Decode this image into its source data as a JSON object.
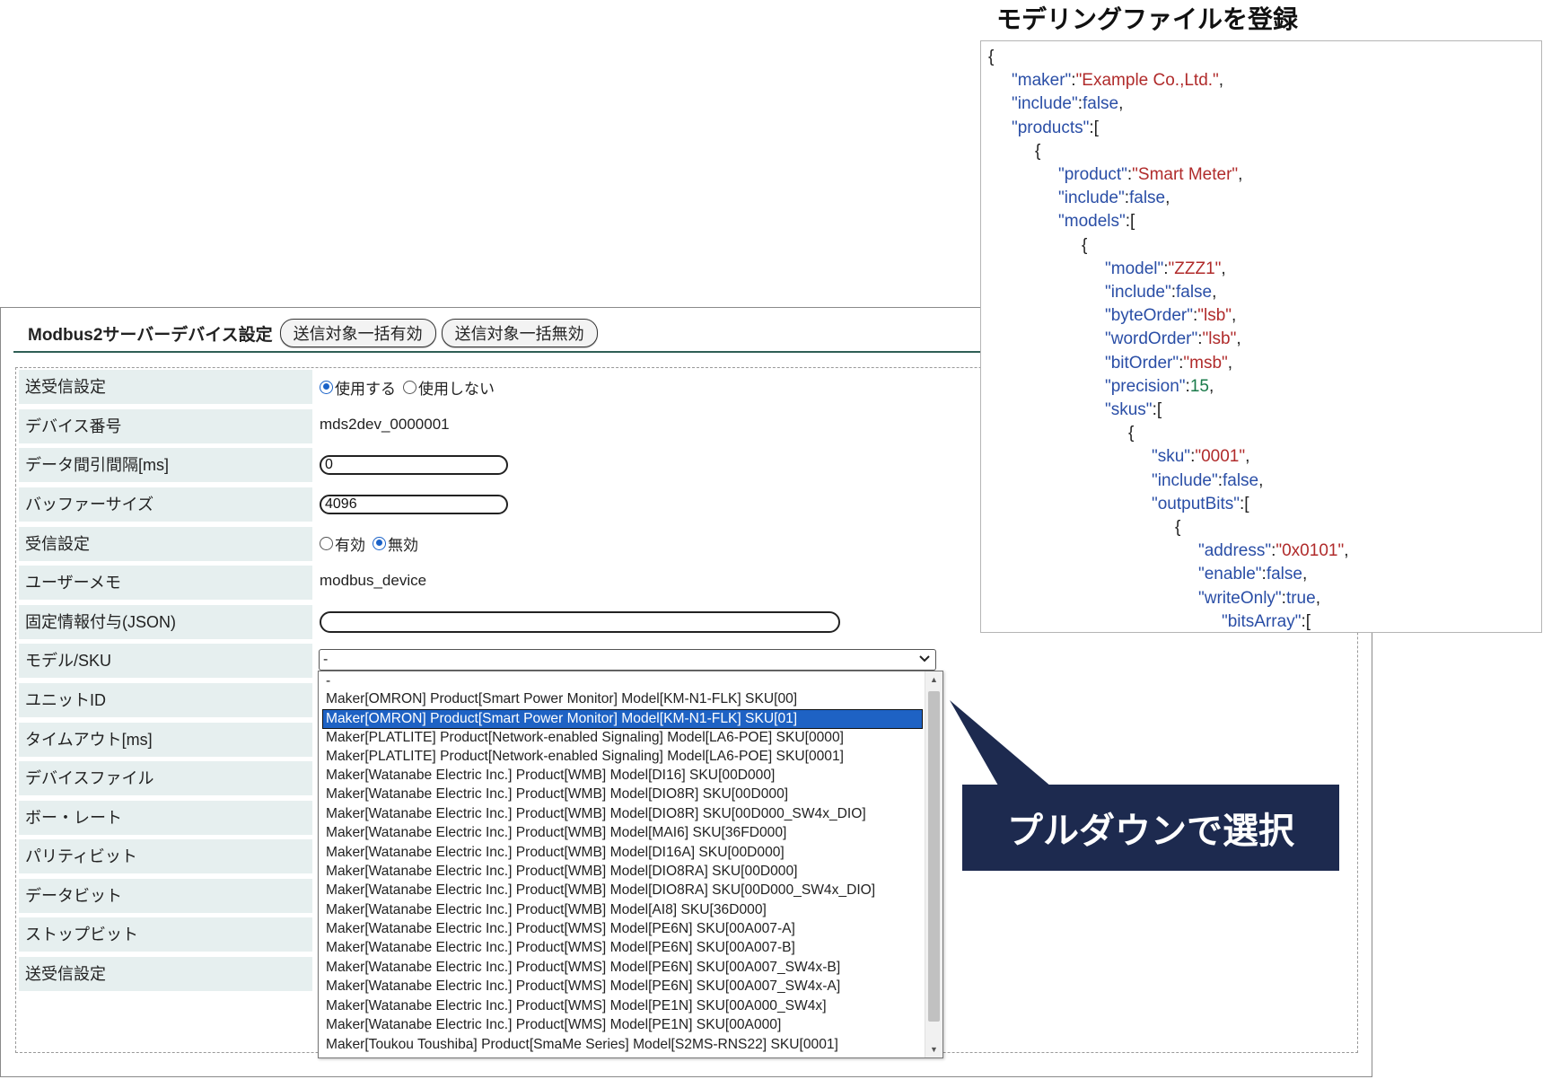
{
  "panel": {
    "title": "Modbus2サーバーデバイス設定",
    "enable_all_label": "送信対象一括有効",
    "disable_all_label": "送信対象一括無効"
  },
  "form": {
    "rows": [
      {
        "label": "送受信設定"
      },
      {
        "label": "デバイス番号"
      },
      {
        "label": "データ間引間隔[ms]"
      },
      {
        "label": "バッファーサイズ"
      },
      {
        "label": "受信設定"
      },
      {
        "label": "ユーザーメモ"
      },
      {
        "label": "固定情報付与(JSON)"
      },
      {
        "label": "モデル/SKU"
      },
      {
        "label": "ユニットID"
      },
      {
        "label": "タイムアウト[ms]"
      },
      {
        "label": "デバイスファイル"
      },
      {
        "label": "ボー・レート"
      },
      {
        "label": "パリティビット"
      },
      {
        "label": "データビット"
      },
      {
        "label": "ストップビット"
      },
      {
        "label": "送受信設定"
      }
    ],
    "send_recv": {
      "use_label": "使用する",
      "nouse_label": "使用しない",
      "selected": "use"
    },
    "device_number": "mds2dev_0000001",
    "thinning_interval": "0",
    "buffer_size": "4096",
    "receive": {
      "enabled_label": "有効",
      "disabled_label": "無効",
      "selected": "disabled"
    },
    "user_memo": "modbus_device",
    "fixed_info": "",
    "model_sku": {
      "selected_value": "-"
    }
  },
  "dropdown": {
    "options": [
      "-",
      "Maker[OMRON] Product[Smart Power Monitor] Model[KM-N1-FLK] SKU[00]",
      "Maker[OMRON] Product[Smart Power Monitor] Model[KM-N1-FLK] SKU[01]",
      "Maker[PLATLITE] Product[Network-enabled Signaling] Model[LA6-POE] SKU[0000]",
      "Maker[PLATLITE] Product[Network-enabled Signaling] Model[LA6-POE] SKU[0001]",
      "Maker[Watanabe Electric Inc.] Product[WMB] Model[DI16] SKU[00D000]",
      "Maker[Watanabe Electric Inc.] Product[WMB] Model[DIO8R] SKU[00D000]",
      "Maker[Watanabe Electric Inc.] Product[WMB] Model[DIO8R] SKU[00D000_SW4x_DIO]",
      "Maker[Watanabe Electric Inc.] Product[WMB] Model[MAI6] SKU[36FD000]",
      "Maker[Watanabe Electric Inc.] Product[WMB] Model[DI16A] SKU[00D000]",
      "Maker[Watanabe Electric Inc.] Product[WMB] Model[DIO8RA] SKU[00D000]",
      "Maker[Watanabe Electric Inc.] Product[WMB] Model[DIO8RA] SKU[00D000_SW4x_DIO]",
      "Maker[Watanabe Electric Inc.] Product[WMB] Model[AI8] SKU[36D000]",
      "Maker[Watanabe Electric Inc.] Product[WMS] Model[PE6N] SKU[00A007-A]",
      "Maker[Watanabe Electric Inc.] Product[WMS] Model[PE6N] SKU[00A007-B]",
      "Maker[Watanabe Electric Inc.] Product[WMS] Model[PE6N] SKU[00A007_SW4x-B]",
      "Maker[Watanabe Electric Inc.] Product[WMS] Model[PE6N] SKU[00A007_SW4x-A]",
      "Maker[Watanabe Electric Inc.] Product[WMS] Model[PE1N] SKU[00A000_SW4x]",
      "Maker[Watanabe Electric Inc.] Product[WMS] Model[PE1N] SKU[00A000]",
      "Maker[Toukou Toushiba] Product[SmaMe Series] Model[S2MS-RNS22] SKU[0001]"
    ],
    "highlighted_index": 2
  },
  "callout": {
    "text": "プルダウンで選択",
    "color": "#1d2a4f"
  },
  "json_panel": {
    "title": "モデリングファイルを登録",
    "lines": [
      {
        "indent": 0,
        "parts": [
          {
            "t": "p",
            "v": "{"
          }
        ]
      },
      {
        "indent": 1,
        "parts": [
          {
            "t": "k",
            "v": "\"maker\""
          },
          {
            "t": "p",
            "v": ":"
          },
          {
            "t": "s",
            "v": "\"Example Co.,Ltd.\""
          },
          {
            "t": "p",
            "v": ","
          }
        ]
      },
      {
        "indent": 1,
        "parts": [
          {
            "t": "k",
            "v": "\"include\""
          },
          {
            "t": "p",
            "v": ":"
          },
          {
            "t": "b",
            "v": "false"
          },
          {
            "t": "p",
            "v": ","
          }
        ]
      },
      {
        "indent": 1,
        "parts": [
          {
            "t": "k",
            "v": "\"products\""
          },
          {
            "t": "p",
            "v": ":["
          }
        ]
      },
      {
        "indent": 2,
        "parts": [
          {
            "t": "p",
            "v": "{"
          }
        ]
      },
      {
        "indent": 3,
        "parts": [
          {
            "t": "k",
            "v": "\"product\""
          },
          {
            "t": "p",
            "v": ":"
          },
          {
            "t": "s",
            "v": "\"Smart Meter\""
          },
          {
            "t": "p",
            "v": ","
          }
        ]
      },
      {
        "indent": 3,
        "parts": [
          {
            "t": "k",
            "v": "\"include\""
          },
          {
            "t": "p",
            "v": ":"
          },
          {
            "t": "b",
            "v": "false"
          },
          {
            "t": "p",
            "v": ","
          }
        ]
      },
      {
        "indent": 3,
        "parts": [
          {
            "t": "k",
            "v": "\"models\""
          },
          {
            "t": "p",
            "v": ":["
          }
        ]
      },
      {
        "indent": 4,
        "parts": [
          {
            "t": "p",
            "v": "{"
          }
        ]
      },
      {
        "indent": 5,
        "parts": [
          {
            "t": "k",
            "v": "\"model\""
          },
          {
            "t": "p",
            "v": ":"
          },
          {
            "t": "s",
            "v": "\"ZZZ1\""
          },
          {
            "t": "p",
            "v": ","
          }
        ]
      },
      {
        "indent": 5,
        "parts": [
          {
            "t": "k",
            "v": "\"include\""
          },
          {
            "t": "p",
            "v": ":"
          },
          {
            "t": "b",
            "v": "false"
          },
          {
            "t": "p",
            "v": ","
          }
        ]
      },
      {
        "indent": 5,
        "parts": [
          {
            "t": "k",
            "v": "\"byteOrder\""
          },
          {
            "t": "p",
            "v": ":"
          },
          {
            "t": "s",
            "v": "\"lsb\""
          },
          {
            "t": "p",
            "v": ","
          }
        ]
      },
      {
        "indent": 5,
        "parts": [
          {
            "t": "k",
            "v": "\"wordOrder\""
          },
          {
            "t": "p",
            "v": ":"
          },
          {
            "t": "s",
            "v": "\"lsb\""
          },
          {
            "t": "p",
            "v": ","
          }
        ]
      },
      {
        "indent": 5,
        "parts": [
          {
            "t": "k",
            "v": "\"bitOrder\""
          },
          {
            "t": "p",
            "v": ":"
          },
          {
            "t": "s",
            "v": "\"msb\""
          },
          {
            "t": "p",
            "v": ","
          }
        ]
      },
      {
        "indent": 5,
        "parts": [
          {
            "t": "k",
            "v": "\"precision\""
          },
          {
            "t": "p",
            "v": ":"
          },
          {
            "t": "n",
            "v": "15"
          },
          {
            "t": "p",
            "v": ","
          }
        ]
      },
      {
        "indent": 5,
        "parts": [
          {
            "t": "k",
            "v": "\"skus\""
          },
          {
            "t": "p",
            "v": ":["
          }
        ]
      },
      {
        "indent": 6,
        "parts": [
          {
            "t": "p",
            "v": "{"
          }
        ]
      },
      {
        "indent": 7,
        "parts": [
          {
            "t": "k",
            "v": "\"sku\""
          },
          {
            "t": "p",
            "v": ":"
          },
          {
            "t": "s",
            "v": "\"0001\""
          },
          {
            "t": "p",
            "v": ","
          }
        ]
      },
      {
        "indent": 7,
        "parts": [
          {
            "t": "k",
            "v": "\"include\""
          },
          {
            "t": "p",
            "v": ":"
          },
          {
            "t": "b",
            "v": "false"
          },
          {
            "t": "p",
            "v": ","
          }
        ]
      },
      {
        "indent": 7,
        "parts": [
          {
            "t": "k",
            "v": "\"outputBits\""
          },
          {
            "t": "p",
            "v": ":["
          }
        ]
      },
      {
        "indent": 8,
        "parts": [
          {
            "t": "p",
            "v": "{"
          }
        ]
      },
      {
        "indent": 9,
        "parts": [
          {
            "t": "k",
            "v": "\"address\""
          },
          {
            "t": "p",
            "v": ":"
          },
          {
            "t": "s",
            "v": "\"0x0101\""
          },
          {
            "t": "p",
            "v": ","
          }
        ]
      },
      {
        "indent": 9,
        "parts": [
          {
            "t": "k",
            "v": "\"enable\""
          },
          {
            "t": "p",
            "v": ":"
          },
          {
            "t": "b",
            "v": "false"
          },
          {
            "t": "p",
            "v": ","
          }
        ]
      },
      {
        "indent": 9,
        "parts": [
          {
            "t": "k",
            "v": "\"writeOnly\""
          },
          {
            "t": "p",
            "v": ":"
          },
          {
            "t": "b",
            "v": "true"
          },
          {
            "t": "p",
            "v": ","
          }
        ]
      },
      {
        "indent": 10,
        "parts": [
          {
            "t": "k",
            "v": "\"bitsArray\""
          },
          {
            "t": "p",
            "v": ":["
          }
        ]
      }
    ],
    "colors": {
      "key": "#2a4ea6",
      "string": "#b02b2b",
      "number": "#1a7a4a",
      "bool": "#2a4ea6"
    }
  }
}
